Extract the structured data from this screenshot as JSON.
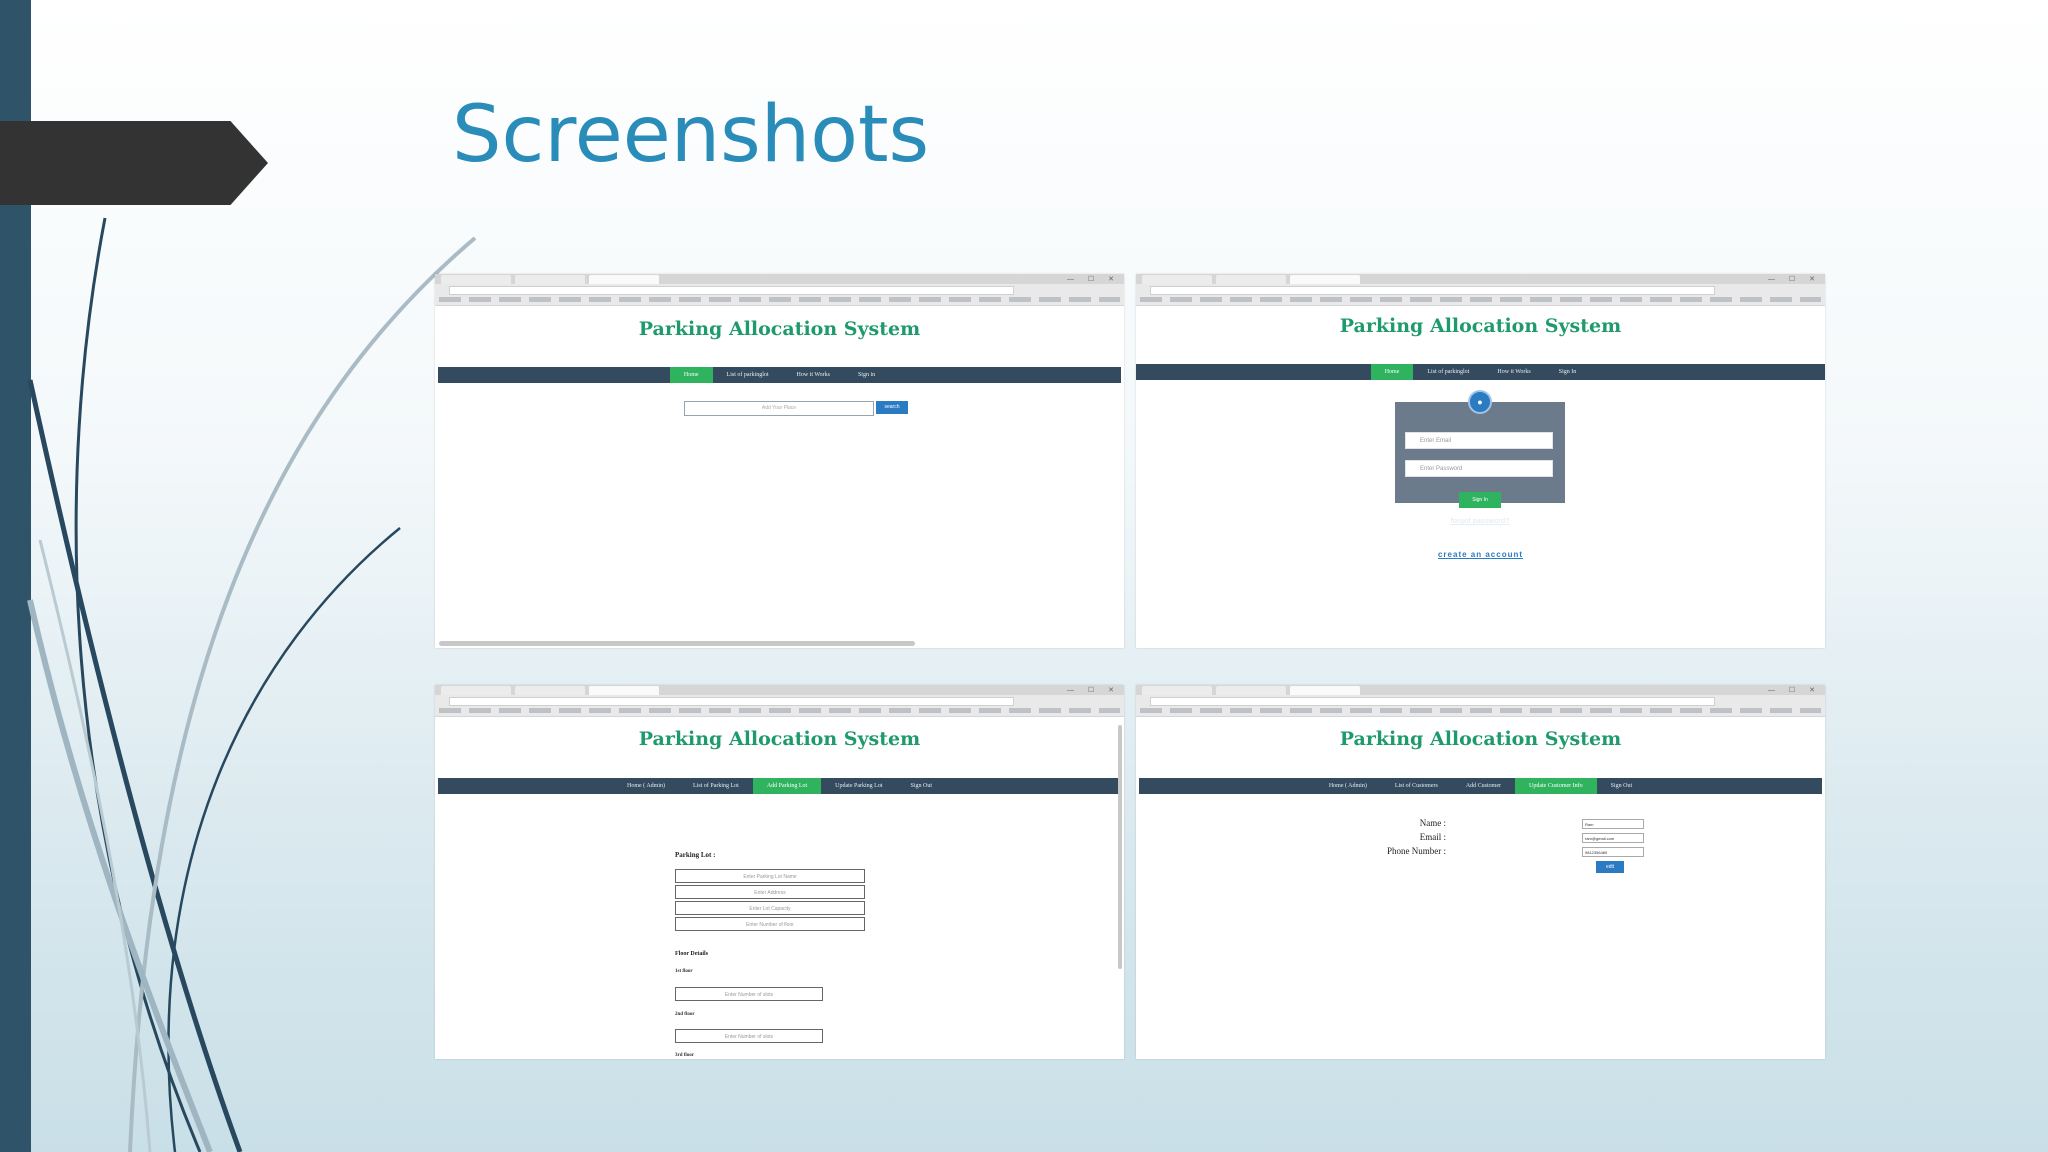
{
  "slide": {
    "title": "Screenshots",
    "colors": {
      "title": "#2a8cb8",
      "left_bar": "#2f5469",
      "banner": "#333333"
    }
  },
  "screens": {
    "home": {
      "heading": "Parking Allocation System",
      "nav": [
        "Home",
        "List of parkinglot",
        "How it Works",
        "Sign in"
      ],
      "active_nav": "Home",
      "search_placeholder": "Add Your Place",
      "search_button": "search"
    },
    "login": {
      "heading": "Parking Allocation System",
      "nav": [
        "Home",
        "List of parkinglot",
        "How it Works",
        "Sign In"
      ],
      "active_nav": "Home",
      "email_placeholder": "Enter Email",
      "password_placeholder": "Enter Password",
      "signin_button": "Sign In",
      "forgot_link": "forgot password?",
      "create_link": "create an account"
    },
    "admin_add_lot": {
      "heading": "Parking Allocation System",
      "nav": [
        "Home ( Admin)",
        "List of Parking Lot",
        "Add Parking Lot",
        "Update Parking Lot",
        "Sign Out"
      ],
      "active_nav": "Add Parking Lot",
      "section_title": "Parking Lot :",
      "lot_fields": [
        "Enter Parking Lot Name",
        "Enter Address",
        "Enter Lot Capacity",
        "Enter Number of floor"
      ],
      "floor_details_title": "Floor Details",
      "floor_labels": [
        "1st floor",
        "2nd floor",
        "3rd floor"
      ],
      "floor_placeholder": "Enter Number of slots"
    },
    "update_customer": {
      "heading": "Parking Allocation System",
      "nav": [
        "Home ( Admin)",
        "List of Customers",
        "Add Customer",
        "Update Customer Info",
        "Sign Out"
      ],
      "active_nav": "Update Customer Info",
      "fields": [
        {
          "label": "Name :",
          "value": "Ram"
        },
        {
          "label": "Email :",
          "value": "ram@gmail.com"
        },
        {
          "label": "Phone Number :",
          "value": "9812356489"
        }
      ],
      "update_button": "edit"
    }
  }
}
